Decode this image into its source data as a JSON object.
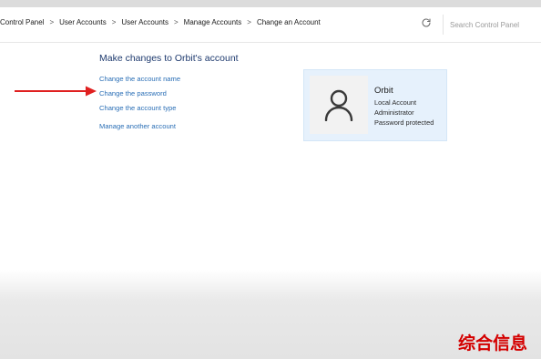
{
  "breadcrumb": {
    "items": [
      "Control Panel",
      "User Accounts",
      "User Accounts",
      "Manage Accounts",
      "Change an Account"
    ],
    "separator": ">"
  },
  "search": {
    "placeholder": "Search Control Panel"
  },
  "main": {
    "heading": "Make changes to Orbit's account",
    "links": [
      "Change the account name",
      "Change the password",
      "Change the account type",
      "Manage another account"
    ]
  },
  "account": {
    "name": "Orbit",
    "type": "Local Account",
    "role": "Administrator",
    "status": "Password protected"
  },
  "annotation": {
    "arrow_color": "#e02020",
    "points_to": "Change the password"
  },
  "watermark": {
    "text": "综合信息"
  },
  "icons": {
    "refresh": "refresh-icon",
    "avatar": "user-icon"
  },
  "colors": {
    "link": "#2b6fb6",
    "heading": "#1e3a6e",
    "card_bg": "#e6f1fc",
    "watermark": "#d40000"
  }
}
